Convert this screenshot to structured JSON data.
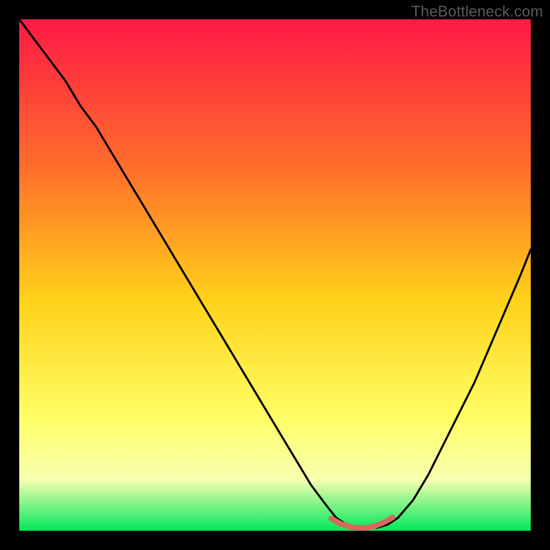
{
  "watermark": "TheBottleneck.com",
  "colors": {
    "frame": "#000000",
    "gradient_top": "#ff1a46",
    "gradient_mid_upper": "#ff6a2c",
    "gradient_mid": "#ffd21a",
    "gradient_lower": "#ffff66",
    "gradient_pale": "#f7ffb0",
    "gradient_bottom": "#00e85a",
    "curve": "#000000",
    "marker": "#d46a5e"
  },
  "chart_data": {
    "type": "line",
    "title": "",
    "xlabel": "",
    "ylabel": "",
    "xlim": [
      0,
      100
    ],
    "ylim": [
      0,
      100
    ],
    "series": [
      {
        "name": "bottleneck-curve",
        "x": [
          0,
          3,
          6,
          9,
          12,
          15,
          18,
          21,
          24,
          27,
          30,
          33,
          36,
          39,
          42,
          45,
          48,
          51,
          54,
          57,
          60,
          62,
          64,
          66,
          68,
          70,
          72,
          74,
          77,
          80,
          83,
          86,
          89,
          92,
          95,
          98,
          100
        ],
        "y": [
          100,
          96,
          92,
          88,
          83,
          79,
          74,
          69,
          64,
          59,
          54,
          49,
          44,
          39,
          34,
          29,
          24,
          19,
          14,
          9,
          5,
          2.5,
          1.2,
          0.6,
          0.5,
          0.6,
          1.2,
          2.5,
          6,
          11,
          17,
          23,
          29,
          36,
          43,
          50,
          55
        ]
      },
      {
        "name": "optimal-range-highlight",
        "x": [
          61,
          62,
          63,
          64,
          65,
          66,
          67,
          68,
          69,
          70,
          71,
          72,
          73
        ],
        "y": [
          2.4,
          1.8,
          1.3,
          1.0,
          0.7,
          0.6,
          0.5,
          0.6,
          0.8,
          1.1,
          1.5,
          2.0,
          2.6
        ]
      }
    ]
  }
}
